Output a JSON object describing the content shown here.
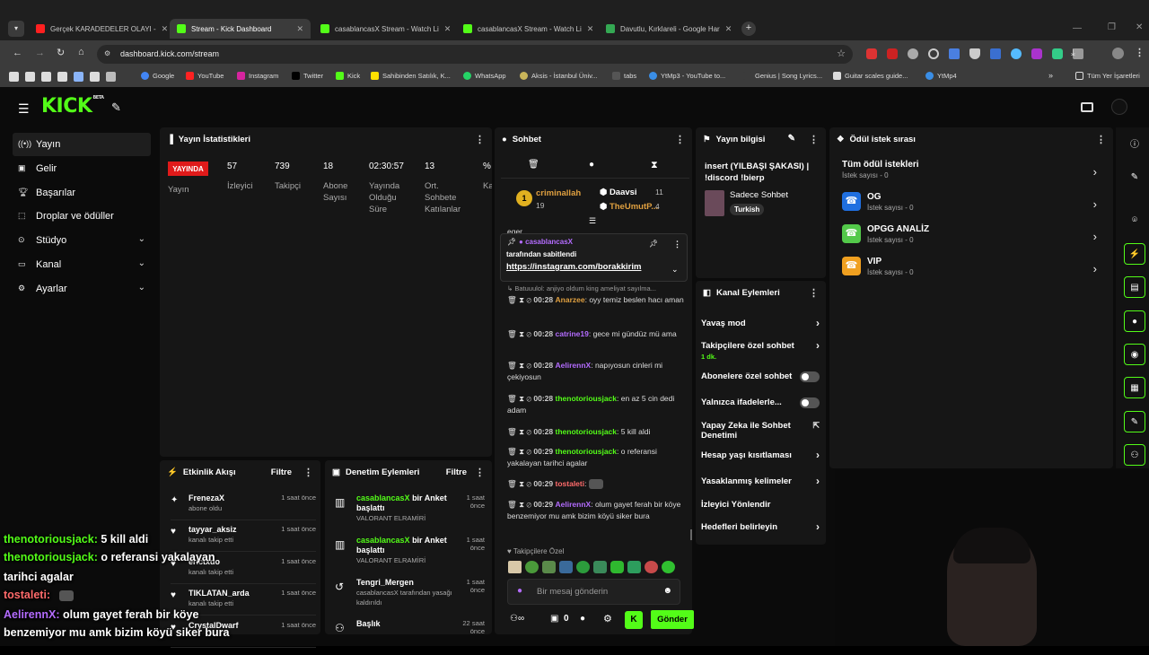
{
  "browser": {
    "tabs": [
      {
        "label": "Gerçek KARADEDELER OLAYI -",
        "color": "#ff2020"
      },
      {
        "label": "Stream - Kick Dashboard",
        "color": "#53fc18"
      },
      {
        "label": "casablancasX Stream - Watch Li",
        "color": "#53fc18"
      },
      {
        "label": "casablancasX Stream - Watch Li",
        "color": "#53fc18"
      },
      {
        "label": "Davutlu, Kırklareli - Google Har",
        "color": "#34a853"
      }
    ],
    "url": "dashboard.kick.com/stream",
    "bookmarks": [
      "Google",
      "YouTube",
      "Instagram",
      "Twitter",
      "Kick",
      "Sahibinden Satılık, K...",
      "WhatsApp",
      "Aksis - İstanbul Üniv...",
      "tabs",
      "YtMp3 - YouTube to...",
      "Genius | Song Lyrics...",
      "Guitar scales guide...",
      "YtMp4"
    ],
    "all_bookmarks": "Tüm Yer İşaretleri"
  },
  "logo": "KICK",
  "logo_badge": "BETA",
  "sidebar": [
    {
      "label": "Yayın",
      "icon": "broadcast-icon"
    },
    {
      "label": "Gelir",
      "icon": "revenue-icon"
    },
    {
      "label": "Başarılar",
      "icon": "trophy-icon"
    },
    {
      "label": "Droplar ve ödüller",
      "icon": "gift-icon"
    },
    {
      "label": "Stüdyo",
      "icon": "studio-icon"
    },
    {
      "label": "Kanal",
      "icon": "channel-icon"
    },
    {
      "label": "Ayarlar",
      "icon": "gear-icon"
    }
  ],
  "stats": {
    "title": "Yayın İstatistikleri",
    "live_badge": "YAYINDA",
    "live_label": "Yayın",
    "items": [
      {
        "value": "57",
        "label": "İzleyici"
      },
      {
        "value": "739",
        "label": "Takipçi"
      },
      {
        "value": "18",
        "label": "Abone Sayısı"
      },
      {
        "value": "02:30:57",
        "label": "Yayında Olduğu Süre"
      },
      {
        "value": "13",
        "label": "Ort. Sohbete Katılanlar"
      },
      {
        "value": "%",
        "label": "Ka"
      }
    ]
  },
  "chat": {
    "title": "Sohbet",
    "top": [
      {
        "rank": "1",
        "name": "criminallah",
        "count": "19"
      },
      {
        "name": "Daavsi",
        "count": "11"
      },
      {
        "name": "TheUmutP...",
        "count": "4"
      }
    ],
    "partial": "eger",
    "pinned": {
      "user": "casablancasX",
      "by": "tarafından sabitlendi",
      "link": "https://instagram.com/borakkirim"
    },
    "reply": "Batuuulol: anjiyo oldum king ameliyat sayılma...",
    "messages": [
      {
        "time": "00:28",
        "user": "Anarzee",
        "color": "orange",
        "text": "oyy temiz beslen hacı aman"
      },
      {
        "time": "00:28",
        "user": "catrine19",
        "color": "purp",
        "text": "gece mi gündüz mü ama"
      },
      {
        "time": "00:28",
        "user": "AelirennX",
        "color": "purp",
        "text": "napıyosun cinleri mi çekiyosun"
      },
      {
        "time": "00:28",
        "user": "thenotoriousjack",
        "color": "green",
        "text": "en az 5 cin dedi adam"
      },
      {
        "time": "00:28",
        "user": "thenotoriousjack",
        "color": "green",
        "text": "5 kill aldi"
      },
      {
        "time": "00:29",
        "user": "thenotoriousjack",
        "color": "green",
        "text": "o referansi yakalayan tarihci agalar"
      },
      {
        "time": "00:29",
        "user": "tostaleti",
        "color": "red",
        "text": ""
      },
      {
        "time": "00:29",
        "user": "AelirennX",
        "color": "purp",
        "text": "olum gayet ferah bir köye benzemiyor mu amk bizim köyü siker bura"
      }
    ],
    "followers_only": "Takipçilere Özel",
    "input_placeholder": "Bir mesaj gönderin",
    "points": "0",
    "send": "Gönder"
  },
  "info": {
    "title": "Yayın bilgisi",
    "stream_title": "insert (YILBAŞI ŞAKASI) | !discord !bierp",
    "category": "Sadece Sohbet",
    "tag": "Turkish"
  },
  "actions": {
    "title": "Kanal Eylemleri",
    "items": [
      {
        "label": "Yavaş mod",
        "type": "arrow"
      },
      {
        "label": "Takipçilere özel sohbet",
        "sub": "1 dk.",
        "type": "arrow"
      },
      {
        "label": "Abonelere özel sohbet",
        "type": "toggle"
      },
      {
        "label": "Yalnızca ifadelerle...",
        "type": "toggle"
      },
      {
        "label": "Yapay Zeka ile Sohbet Denetimi",
        "type": "ext"
      },
      {
        "label": "Hesap yaşı kısıtlaması",
        "type": "arrow"
      },
      {
        "label": "Yasaklanmış kelimeler",
        "type": "arrow"
      },
      {
        "label": "İzleyici Yönlendir",
        "type": "none"
      },
      {
        "label": "Hedefleri belirleyin",
        "type": "arrow"
      }
    ]
  },
  "rewards": {
    "title": "Ödül istek sırası",
    "items": [
      {
        "label": "Tüm ödül istekleri",
        "sub": "İstek sayısı - 0",
        "color": ""
      },
      {
        "label": "OG",
        "sub": "İstek sayısı - 0",
        "color": "#1f6fe0"
      },
      {
        "label": "OPGG ANALİZ",
        "sub": "İstek sayısı - 0",
        "color": "#53c94a"
      },
      {
        "label": "VIP",
        "sub": "İstek sayısı - 0",
        "color": "#f0a020"
      }
    ]
  },
  "activity": {
    "title": "Etkinlik Akışı",
    "filter": "Filtre",
    "items": [
      {
        "name": "FrenezaX",
        "sub": "abone oldu",
        "time": "1 saat önce"
      },
      {
        "name": "tayyar_aksiz",
        "sub": "kanalı takip etti",
        "time": "1 saat önce"
      },
      {
        "name": "erictxdo",
        "sub": "kanalı takip etti",
        "time": "1 saat önce"
      },
      {
        "name": "TIKLATAN_arda",
        "sub": "kanalı takip etti",
        "time": "1 saat önce"
      },
      {
        "name": "CrystalDwarf",
        "sub": "",
        "time": "1 saat önce"
      }
    ]
  },
  "modlog": {
    "title": "Denetim Eylemleri",
    "filter": "Filtre",
    "items": [
      {
        "user": "casablancasX",
        "text": "bir Anket başlattı",
        "sub": "VALORANT ELRAMİRİ",
        "time": "1 saat önce"
      },
      {
        "user": "casablancasX",
        "text": "bir Anket başlattı",
        "sub": "VALORANT ELRAMİRİ",
        "time": "1 saat önce"
      },
      {
        "user": "Tengri_Mergen",
        "text": "",
        "sub": "casablancasX tarafından yasağı kaldırıldı",
        "time": "1 saat önce"
      },
      {
        "user": "Başlık",
        "text": "",
        "sub": "",
        "time": "22 saat önce"
      }
    ]
  },
  "overlay": [
    {
      "user": "thenotoriousjack:",
      "text": "5 kill aldi"
    },
    {
      "user": "thenotoriousjack:",
      "text": "o referansi yakalayan"
    },
    {
      "user": "",
      "text": "tarihci agalar"
    },
    {
      "user": "tostaleti:",
      "text": ""
    },
    {
      "user": "AelirennX:",
      "text": "olum gayet ferah bir köye"
    },
    {
      "user": "",
      "text": "benzemiyor mu amk bizim köyü siker bura"
    }
  ]
}
